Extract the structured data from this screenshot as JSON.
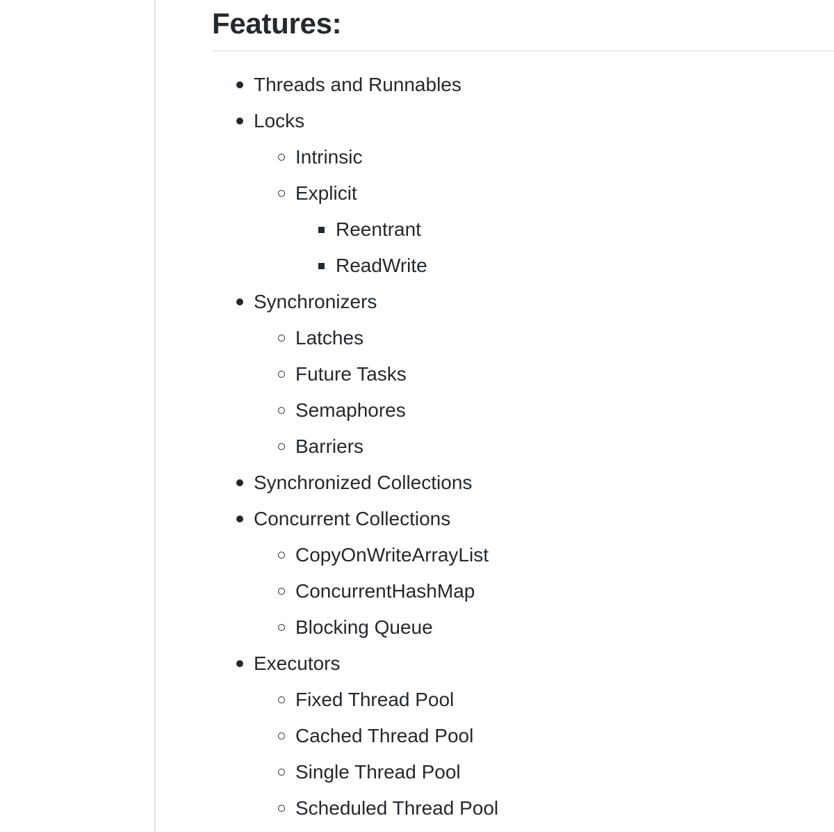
{
  "document": {
    "heading": "Features:",
    "divider_color": "#e3e5e8",
    "rule_color": "#eaecef",
    "text_color": "#24292e",
    "background_color": "#ffffff",
    "bullet_markers": {
      "level_1": "disc",
      "level_2": "circle",
      "level_3": "square"
    },
    "features": [
      {
        "label": "Threads and Runnables",
        "children": []
      },
      {
        "label": "Locks",
        "children": [
          {
            "label": "Intrinsic",
            "children": []
          },
          {
            "label": "Explicit",
            "children": [
              {
                "label": "Reentrant"
              },
              {
                "label": "ReadWrite"
              }
            ]
          }
        ]
      },
      {
        "label": "Synchronizers",
        "children": [
          {
            "label": "Latches",
            "children": []
          },
          {
            "label": "Future Tasks",
            "children": []
          },
          {
            "label": "Semaphores",
            "children": []
          },
          {
            "label": "Barriers",
            "children": []
          }
        ]
      },
      {
        "label": "Synchronized Collections",
        "children": []
      },
      {
        "label": "Concurrent Collections",
        "children": [
          {
            "label": "CopyOnWriteArrayList",
            "children": []
          },
          {
            "label": "ConcurrentHashMap",
            "children": []
          },
          {
            "label": "Blocking Queue",
            "children": []
          }
        ]
      },
      {
        "label": "Executors",
        "children": [
          {
            "label": "Fixed Thread Pool",
            "children": []
          },
          {
            "label": "Cached Thread Pool",
            "children": []
          },
          {
            "label": "Single Thread Pool",
            "children": []
          },
          {
            "label": "Scheduled Thread Pool",
            "children": []
          }
        ]
      }
    ]
  }
}
